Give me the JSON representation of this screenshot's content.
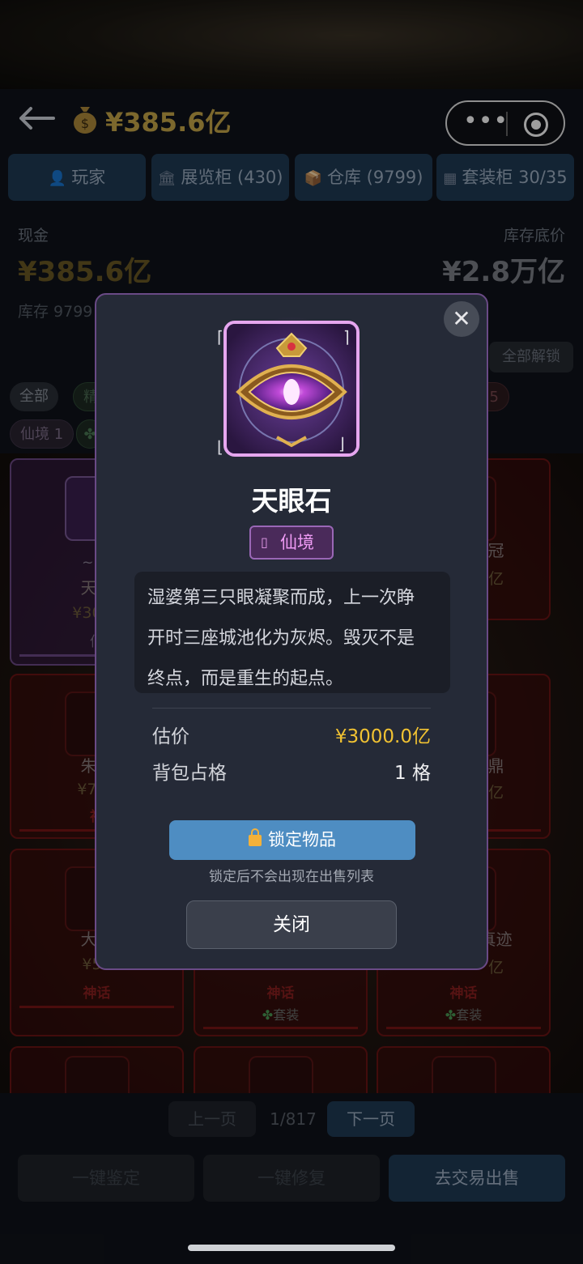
{
  "topbar": {
    "cash": "¥385.6亿"
  },
  "tabs": [
    {
      "label": "玩家",
      "icon": "person-icon"
    },
    {
      "label": "展览柜 (430)",
      "icon": "museum-icon"
    },
    {
      "label": "仓库 (9799)",
      "icon": "box-icon"
    },
    {
      "label": "套装柜 30/35",
      "icon": "bag-icon"
    }
  ],
  "stats": {
    "cash_label": "现金",
    "cash_value": "¥385.6亿",
    "floor_label": "库存底价",
    "floor_value": "¥2.8万亿",
    "stock_label": "库存 9799"
  },
  "unlock_all": "全部解锁",
  "filters": {
    "all": "全部",
    "jing": "精",
    "count_75": "75",
    "xianjing": "仙境 1"
  },
  "cards": [
    {
      "name": "天眼",
      "price": "¥3000",
      "tier": "仙",
      "sub": "~ 仙"
    },
    {
      "name": "朱雀",
      "price": "¥700",
      "tier": "神"
    },
    {
      "name": "冠",
      "price": "亿"
    },
    {
      "name": "大禹",
      "price": "¥50",
      "tier": "神话"
    },
    {
      "name": "",
      "price": "",
      "tier": "神话",
      "set": "套装"
    },
    {
      "name": "真迹",
      "price": "亿",
      "tier": "神话",
      "set": "套装"
    },
    {
      "name": "鼎",
      "price": "亿"
    }
  ],
  "pager": {
    "prev": "上一页",
    "page": "1/817",
    "next": "下一页"
  },
  "actions": {
    "identify": "一键鉴定",
    "repair": "一键修复",
    "trade": "去交易出售"
  },
  "modal": {
    "item_name": "天眼石",
    "tier": "仙境",
    "description_lines": [
      "湿婆第三只眼凝聚而成，上一次睁",
      "开时三座城池化为灰烬。毁灭不是",
      "终点，而是重生的起点。"
    ],
    "estimate_label": "估价",
    "estimate_value": "¥3000.0亿",
    "slots_label": "背包占格",
    "slots_value": "1 格",
    "lock_button": "锁定物品",
    "lock_hint": "锁定后不会出现在出售列表",
    "close_button": "关闭"
  },
  "colors": {
    "gold": "#f1c232",
    "tier_purple": "#ef9bf5",
    "accent_blue": "#4e8dc2",
    "mythic_red": "#6b1414"
  }
}
